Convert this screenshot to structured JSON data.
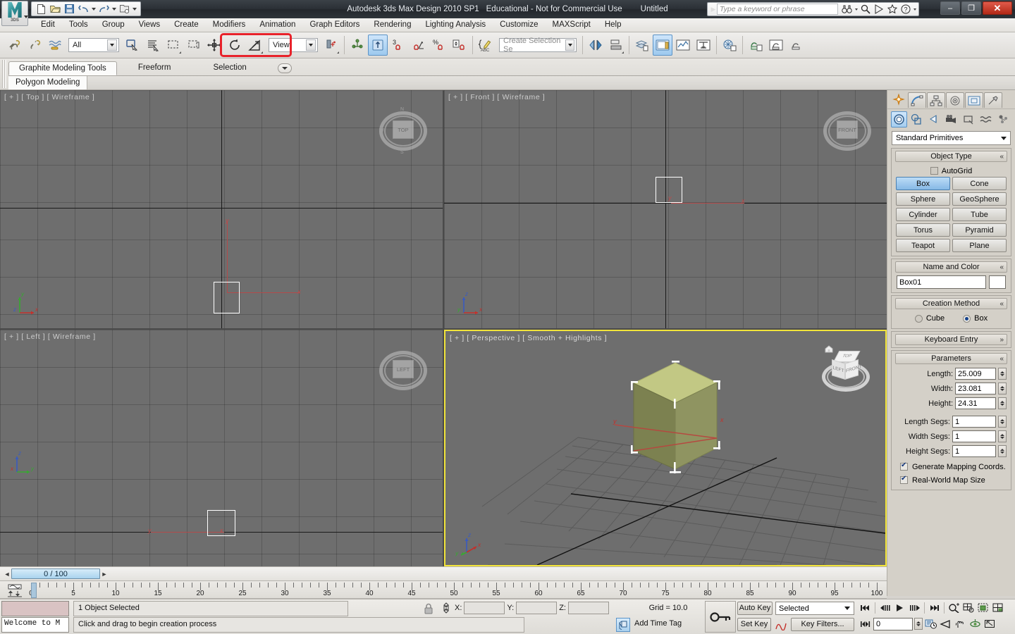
{
  "titlebar": {
    "app_title": "Autodesk 3ds Max Design 2010 SP1",
    "license": "Educational - Not for Commercial Use",
    "document": "Untitled",
    "logo_label": "3DS",
    "search_placeholder": "Type a keyword or phrase",
    "quick_access": [
      {
        "name": "new-file-icon",
        "glyph": "new"
      },
      {
        "name": "open-file-icon",
        "glyph": "open"
      },
      {
        "name": "save-file-icon",
        "glyph": "save"
      },
      {
        "name": "undo-icon",
        "glyph": "undo"
      },
      {
        "name": "redo-icon",
        "glyph": "redo"
      },
      {
        "name": "set-project-folder-icon",
        "glyph": "project"
      }
    ],
    "help_icons": [
      {
        "name": "search-binoculars-icon"
      },
      {
        "name": "magnifier-icon"
      },
      {
        "name": "subscription-icon"
      },
      {
        "name": "favorites-star-icon"
      },
      {
        "name": "help-question-icon"
      }
    ],
    "window_buttons": {
      "minimize": "–",
      "maximize": "❐",
      "close": "✕"
    }
  },
  "menubar": {
    "items": [
      "Edit",
      "Tools",
      "Group",
      "Views",
      "Create",
      "Modifiers",
      "Animation",
      "Graph Editors",
      "Rendering",
      "Lighting Analysis",
      "Customize",
      "MAXScript",
      "Help"
    ]
  },
  "toolbar": {
    "selection_filter": "All",
    "reference_coord_system": "View",
    "named_selection_set": "Create Selection Se",
    "snap_percent_label": "3",
    "highlight_color": "#e8222a",
    "buttons": [
      {
        "name": "select-and-link-icon"
      },
      {
        "name": "unlink-selection-icon"
      },
      {
        "name": "bind-to-space-warp-icon"
      },
      {
        "name": "select-object-icon"
      },
      {
        "name": "select-by-name-icon"
      },
      {
        "name": "rectangular-selection-region-icon"
      },
      {
        "name": "window-crossing-icon"
      },
      {
        "name": "select-and-move-icon"
      },
      {
        "name": "select-and-rotate-icon"
      },
      {
        "name": "select-and-scale-icon"
      },
      {
        "name": "use-center-flyout-icon"
      },
      {
        "name": "select-and-manipulate-icon"
      },
      {
        "name": "snaps-toggle-icon"
      },
      {
        "name": "angle-snap-toggle-icon"
      },
      {
        "name": "percent-snap-toggle-icon"
      },
      {
        "name": "spinner-snap-toggle-icon"
      },
      {
        "name": "edit-named-selection-sets-icon"
      },
      {
        "name": "mirror-icon"
      },
      {
        "name": "align-icon"
      },
      {
        "name": "layer-manager-icon"
      },
      {
        "name": "curve-editor-icon"
      },
      {
        "name": "schematic-view-icon"
      },
      {
        "name": "material-editor-icon"
      },
      {
        "name": "render-setup-icon"
      },
      {
        "name": "rendered-frame-window-icon"
      },
      {
        "name": "render-production-icon"
      }
    ]
  },
  "ribbon": {
    "tabs": [
      {
        "label": "Graphite Modeling Tools",
        "selected": true
      },
      {
        "label": "Freeform",
        "selected": false
      },
      {
        "label": "Selection",
        "selected": false
      }
    ],
    "panel": "Polygon Modeling",
    "dropdown_icon": "chevron-down-icon"
  },
  "viewports": [
    {
      "id": "top",
      "label": "[ + ] [ Top ] [ Wireframe ]",
      "active": false,
      "viewcube_face": "TOP"
    },
    {
      "id": "front",
      "label": "[ + ] [ Front ] [ Wireframe ]",
      "active": false,
      "viewcube_face": "FRONT"
    },
    {
      "id": "left",
      "label": "[ + ] [ Left ] [ Wireframe ]",
      "active": false,
      "viewcube_face": "LEFT"
    },
    {
      "id": "perspective",
      "label": "[ + ] [ Perspective ] [ Smooth + Highlights ]",
      "active": true,
      "viewcube_faces": {
        "top": "TOP",
        "left": "LEFT",
        "right": "FRONT"
      },
      "active_border_color": "#f2e43a",
      "object_color": "#a8ad70"
    }
  ],
  "axis_labels": {
    "x": "x",
    "y": "y",
    "z": "z"
  },
  "command_panel": {
    "tabs": [
      {
        "name": "create-tab",
        "selected": true
      },
      {
        "name": "modify-tab",
        "selected": false
      },
      {
        "name": "hierarchy-tab",
        "selected": false
      },
      {
        "name": "motion-tab",
        "selected": false
      },
      {
        "name": "display-tab",
        "selected": false
      },
      {
        "name": "utilities-tab",
        "selected": false
      }
    ],
    "categories": [
      {
        "name": "geometry-category",
        "selected": true
      },
      {
        "name": "shapes-category",
        "selected": false
      },
      {
        "name": "lights-category",
        "selected": false
      },
      {
        "name": "cameras-category",
        "selected": false
      },
      {
        "name": "helpers-category",
        "selected": false
      },
      {
        "name": "space-warps-category",
        "selected": false
      },
      {
        "name": "systems-category",
        "selected": false
      }
    ],
    "subcategory": "Standard Primitives",
    "object_type": {
      "title": "Object Type",
      "autogrid_label": "AutoGrid",
      "autogrid_checked": false,
      "buttons": [
        {
          "label": "Box",
          "selected": true
        },
        {
          "label": "Cone",
          "selected": false
        },
        {
          "label": "Sphere",
          "selected": false
        },
        {
          "label": "GeoSphere",
          "selected": false
        },
        {
          "label": "Cylinder",
          "selected": false
        },
        {
          "label": "Tube",
          "selected": false
        },
        {
          "label": "Torus",
          "selected": false
        },
        {
          "label": "Pyramid",
          "selected": false
        },
        {
          "label": "Teapot",
          "selected": false
        },
        {
          "label": "Plane",
          "selected": false
        }
      ]
    },
    "name_and_color": {
      "title": "Name and Color",
      "object_name": "Box01",
      "color": "#ffffff"
    },
    "creation_method": {
      "title": "Creation Method",
      "options": [
        {
          "label": "Cube",
          "selected": false
        },
        {
          "label": "Box",
          "selected": true
        }
      ]
    },
    "keyboard_entry": {
      "title": "Keyboard Entry",
      "collapsed": true
    },
    "parameters": {
      "title": "Parameters",
      "fields": [
        {
          "label": "Length:",
          "value": "25.009"
        },
        {
          "label": "Width:",
          "value": "23.081"
        },
        {
          "label": "Height:",
          "value": "24.31"
        }
      ],
      "segments": [
        {
          "label": "Length Segs:",
          "value": "1"
        },
        {
          "label": "Width Segs:",
          "value": "1"
        },
        {
          "label": "Height Segs:",
          "value": "1"
        }
      ],
      "checkboxes": [
        {
          "label": "Generate Mapping Coords.",
          "checked": true
        },
        {
          "label": "Real-World Map Size",
          "checked": true
        }
      ]
    }
  },
  "time_slider": {
    "current_frame_label": "0 / 100",
    "prev_arrow": "◄",
    "next_arrow": "►"
  },
  "track_bar": {
    "tick_labels": [
      "5",
      "10",
      "15",
      "20",
      "25",
      "30",
      "35",
      "40",
      "45",
      "50",
      "55",
      "60",
      "65",
      "70",
      "75",
      "80",
      "85",
      "90",
      "95",
      "100"
    ],
    "range_start": 0,
    "range_end": 100
  },
  "status_bar": {
    "maxscript_mini_listener": "Welcome to M",
    "selection_status": "1 Object Selected",
    "prompt": "Click and drag to begin creation process",
    "lock_icon": "lock-selection-icon",
    "coordinates": [
      {
        "label": "X:",
        "value": ""
      },
      {
        "label": "Y:",
        "value": ""
      },
      {
        "label": "Z:",
        "value": ""
      }
    ],
    "grid_info": "Grid = 10.0",
    "add_time_tag": "Add Time Tag",
    "auto_key": "Auto Key",
    "set_key": "Set Key",
    "key_mode_filter": "Selected",
    "key_filters": "Key Filters...",
    "frame_field": "0",
    "playback_buttons": [
      {
        "name": "go-to-start-button"
      },
      {
        "name": "previous-frame-button"
      },
      {
        "name": "play-animation-button"
      },
      {
        "name": "next-frame-button"
      },
      {
        "name": "go-to-end-button"
      }
    ],
    "viewport_nav_buttons": [
      {
        "name": "zoom-icon"
      },
      {
        "name": "zoom-all-icon"
      },
      {
        "name": "zoom-extents-icon"
      },
      {
        "name": "zoom-extents-all-icon"
      },
      {
        "name": "field-of-view-icon"
      },
      {
        "name": "pan-view-icon"
      },
      {
        "name": "orbit-icon"
      },
      {
        "name": "maximize-viewport-toggle-icon"
      }
    ],
    "key_mode_toggle": {
      "name": "key-mode-toggle-button"
    },
    "time-config": {
      "name": "time-configuration-button"
    }
  }
}
